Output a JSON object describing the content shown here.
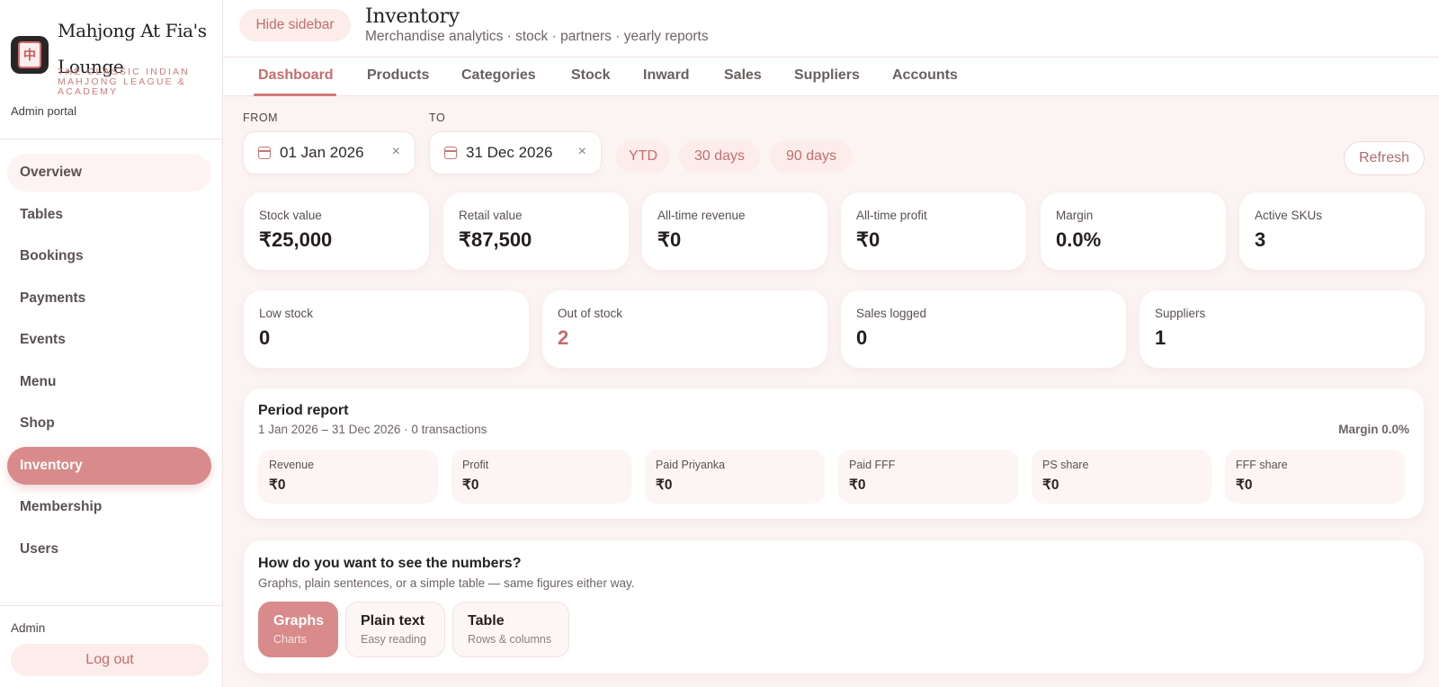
{
  "brand": {
    "name": "Mahjong At Fia's Lounge",
    "tagline": "The Classic Indian Mahjong League & Academy",
    "portal": "Admin portal"
  },
  "sidebar": {
    "items": [
      {
        "label": "Overview"
      },
      {
        "label": "Tables"
      },
      {
        "label": "Bookings"
      },
      {
        "label": "Payments"
      },
      {
        "label": "Events"
      },
      {
        "label": "Menu"
      },
      {
        "label": "Shop"
      },
      {
        "label": "Inventory"
      },
      {
        "label": "Membership"
      },
      {
        "label": "Users"
      }
    ],
    "active": "Inventory",
    "user_role": "Admin",
    "logout_label": "Log out"
  },
  "header": {
    "hide_sidebar_label": "Hide sidebar",
    "title": "Inventory",
    "subtitle": "Merchandise analytics · stock · partners · yearly reports"
  },
  "tabs": [
    {
      "label": "Dashboard"
    },
    {
      "label": "Products"
    },
    {
      "label": "Categories"
    },
    {
      "label": "Stock"
    },
    {
      "label": "Inward"
    },
    {
      "label": "Sales"
    },
    {
      "label": "Suppliers"
    },
    {
      "label": "Accounts"
    }
  ],
  "filters": {
    "from_label": "FROM",
    "to_label": "TO",
    "from_value": "01 Jan 2026",
    "to_value": "31 Dec 2026",
    "clear_glyph": "×",
    "presets": [
      "YTD",
      "30 days",
      "90 days"
    ],
    "refresh_label": "Refresh"
  },
  "stats_row1": [
    {
      "label": "Stock value",
      "value": "₹25,000"
    },
    {
      "label": "Retail value",
      "value": "₹87,500"
    },
    {
      "label": "All-time revenue",
      "value": "₹0"
    },
    {
      "label": "All-time profit",
      "value": "₹0"
    },
    {
      "label": "Margin",
      "value": "0.0%"
    },
    {
      "label": "Active SKUs",
      "value": "3"
    }
  ],
  "stats_row2": [
    {
      "label": "Low stock",
      "value": "0"
    },
    {
      "label": "Out of stock",
      "value": "2"
    },
    {
      "label": "Sales logged",
      "value": "0"
    },
    {
      "label": "Suppliers",
      "value": "1"
    }
  ],
  "period_report": {
    "title": "Period report",
    "subtitle": "1 Jan 2026 – 31 Dec 2026 · 0 transactions",
    "margin": "Margin 0.0%",
    "items": [
      {
        "label": "Revenue",
        "value": "₹0"
      },
      {
        "label": "Profit",
        "value": "₹0"
      },
      {
        "label": "Paid Priyanka",
        "value": "₹0"
      },
      {
        "label": "Paid FFF",
        "value": "₹0"
      },
      {
        "label": "PS share",
        "value": "₹0"
      },
      {
        "label": "FFF share",
        "value": "₹0"
      }
    ]
  },
  "view_mode": {
    "title": "How do you want to see the numbers?",
    "subtitle": "Graphs, plain sentences, or a simple table — same figures either way.",
    "options": [
      {
        "label": "Graphs",
        "sub": "Charts"
      },
      {
        "label": "Plain text",
        "sub": "Easy reading"
      },
      {
        "label": "Table",
        "sub": "Rows & columns"
      }
    ],
    "selected": "Graphs"
  },
  "colors": {
    "accent": "#d98a8a",
    "accent_text": "#c26f6f",
    "chip_bg": "#fcecea",
    "page_bg": "#fbf4f3"
  }
}
